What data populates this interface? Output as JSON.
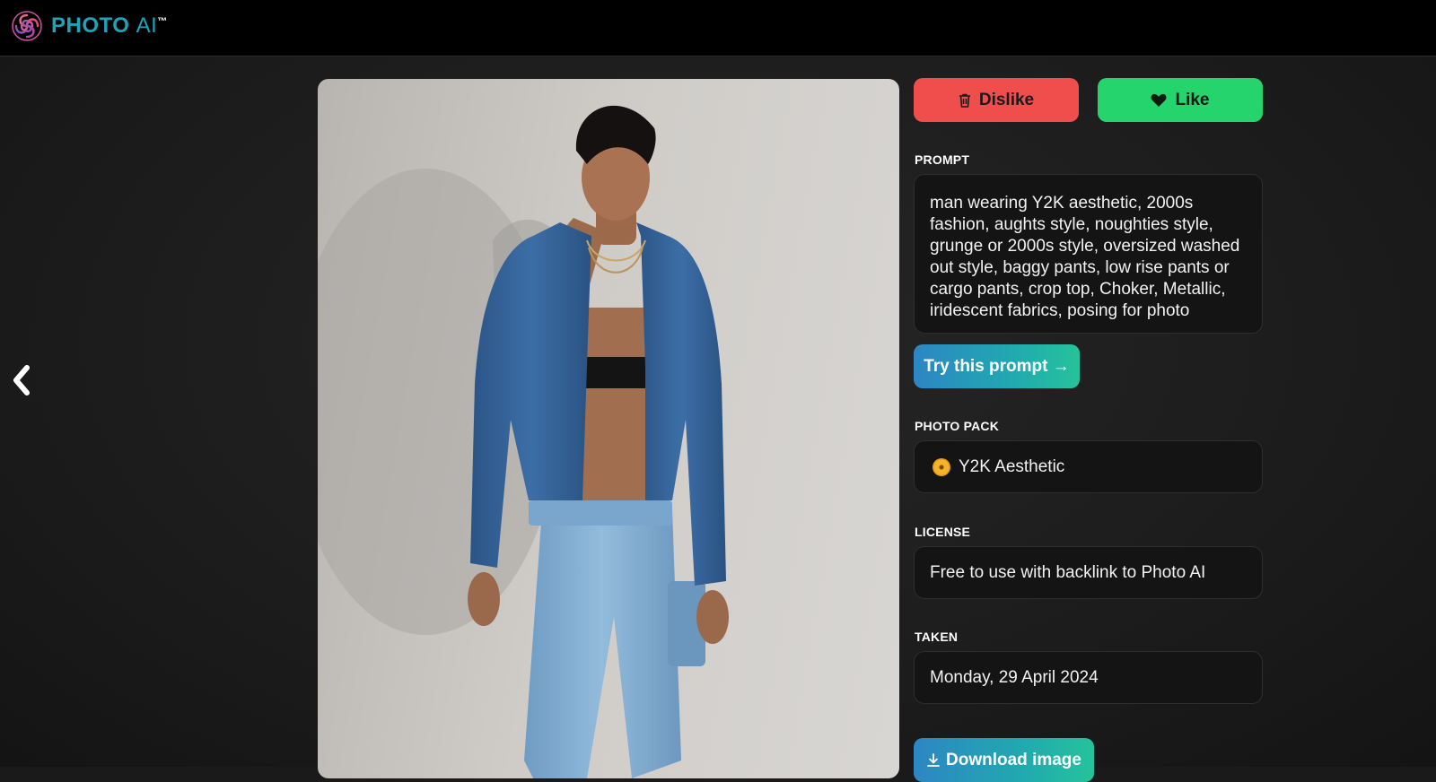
{
  "brand": {
    "name": "PHOTO",
    "suffix": "AI",
    "tm": "™"
  },
  "actions": {
    "dislike_label": "Dislike",
    "like_label": "Like"
  },
  "prompt": {
    "heading": "PROMPT",
    "text": "man wearing Y2K aesthetic, 2000s fashion, aughts style, noughties style, grunge or 2000s style, oversized washed out style, baggy pants, low rise pants or cargo pants, crop top, Choker, Metallic, iridescent fabrics, posing for photo",
    "try_label": "Try this prompt →"
  },
  "photo_pack": {
    "heading": "PHOTO PACK",
    "value": "Y2K Aesthetic",
    "icon": "cd-icon"
  },
  "license": {
    "heading": "LICENSE",
    "value": "Free to use with backlink to Photo AI"
  },
  "taken": {
    "heading": "TAKEN",
    "value": "Monday, 29 April 2024"
  },
  "download_label": "Download image",
  "colors": {
    "dislike": "#f04d4d",
    "like": "#26d46e",
    "accent": "#1fa3b8"
  }
}
